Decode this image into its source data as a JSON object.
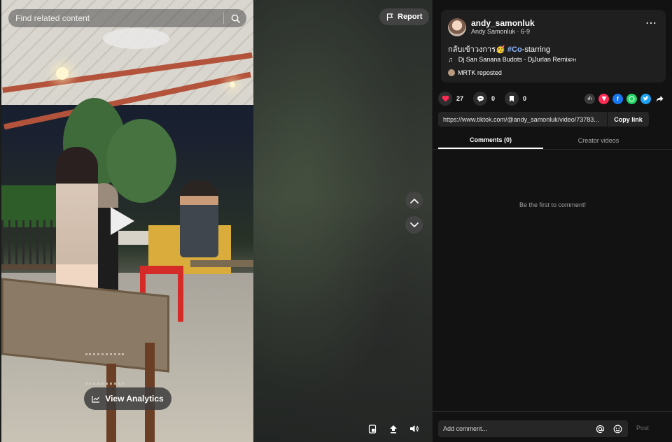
{
  "search": {
    "placeholder": "Find related content"
  },
  "report": {
    "label": "Report"
  },
  "analytics": {
    "label": "View Analytics"
  },
  "author": {
    "handle": "andy_samonluk",
    "display_name": "Andy Samonluk",
    "date": "6-9",
    "subline": "Andy Samonluk · 6-9"
  },
  "caption": {
    "text": "กลับเข้าวงการ🥳",
    "hashtag": "#Co",
    "suffix": "-starring"
  },
  "music": {
    "title": "Dj San Sanana Budots - DjJurlan Remix",
    "suffix": "PH"
  },
  "repost": {
    "text": "MRTK reposted"
  },
  "actions": {
    "likes": "27",
    "comments": "0",
    "saves": "0"
  },
  "share": {
    "url": "https://www.tiktok.com/@andy_samonluk/video/73783...",
    "copy_label": "Copy link"
  },
  "tabs": {
    "comments": "Comments (0)",
    "creator": "Creator videos"
  },
  "comments": {
    "empty": "Be the first to comment!"
  },
  "composer": {
    "placeholder": "Add comment...",
    "post_label": "Post"
  },
  "colors": {
    "like": "#fe2c55",
    "hashtag": "#8fb7ff",
    "panel_bg": "#121212",
    "card_bg": "#1f1f1f",
    "facebook": "#1877f2",
    "whatsapp": "#25d366",
    "twitter": "#1da1f2"
  }
}
